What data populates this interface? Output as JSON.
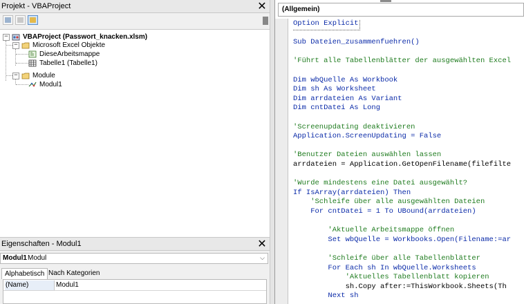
{
  "project_pane": {
    "title": "Projekt - VBAProject",
    "close": "✕",
    "tree": {
      "root": "VBAProject (Passwort_knacken.xlsm)",
      "excel_objects_folder": "Microsoft Excel Objekte",
      "excel_objects": [
        "DieseArbeitsmappe",
        "Tabelle1 (Tabelle1)"
      ],
      "modules_folder": "Module",
      "modules": [
        "Modul1"
      ]
    }
  },
  "properties_pane": {
    "title": "Eigenschaften - Modul1",
    "close": "✕",
    "object_bold": "Modul1",
    "object_type": "Modul",
    "tabs": [
      "Alphabetisch",
      "Nach Kategorien"
    ],
    "rows": [
      {
        "name": "(Name)",
        "value": "Modul1"
      }
    ]
  },
  "code_window": {
    "object_dropdown": "(Allgemein)",
    "lines": [
      {
        "text": "Option Explicit",
        "style": "k"
      },
      {
        "text": "",
        "style": "n"
      },
      {
        "text": "Sub Dateien_zusammenfuehren()",
        "style": "k"
      },
      {
        "text": "",
        "style": "n"
      },
      {
        "text": "'Führt alle Tabellenblätter der ausgewählten Excel",
        "style": "c"
      },
      {
        "text": "",
        "style": "n"
      },
      {
        "text": "Dim wbQuelle As Workbook",
        "style": "k"
      },
      {
        "text": "Dim sh As Worksheet",
        "style": "k"
      },
      {
        "text": "Dim arrdateien As Variant",
        "style": "k"
      },
      {
        "text": "Dim cntDatei As Long",
        "style": "k"
      },
      {
        "text": "",
        "style": "n"
      },
      {
        "text": "'Screenupdating deaktivieren",
        "style": "c"
      },
      {
        "text": "Application.ScreenUpdating = False",
        "style": "k"
      },
      {
        "text": "",
        "style": "n"
      },
      {
        "text": "'Benutzer Dateien auswählen lassen",
        "style": "c"
      },
      {
        "text": "arrdateien = Application.GetOpenFilename(filefilte",
        "style": "n"
      },
      {
        "text": "",
        "style": "n"
      },
      {
        "text": "'Wurde mindestens eine Datei ausgewählt?",
        "style": "c"
      },
      {
        "text": "If IsArray(arrdateien) Then",
        "style": "k"
      },
      {
        "text": "    'Schleife über alle ausgewählten Dateien",
        "style": "c"
      },
      {
        "text": "    For cntDatei = 1 To UBound(arrdateien)",
        "style": "k"
      },
      {
        "text": "",
        "style": "n"
      },
      {
        "text": "        'Aktuelle Arbeitsmappe öffnen",
        "style": "c"
      },
      {
        "text": "        Set wbQuelle = Workbooks.Open(Filename:=ar",
        "style": "k"
      },
      {
        "text": "",
        "style": "n"
      },
      {
        "text": "        'Schleife über alle Tabellenblätter",
        "style": "c"
      },
      {
        "text": "        For Each sh In wbQuelle.Worksheets",
        "style": "k"
      },
      {
        "text": "            'Aktuelles Tabellenblatt kopieren",
        "style": "c"
      },
      {
        "text": "            sh.Copy after:=ThisWorkbook.Sheets(Th",
        "style": "n"
      },
      {
        "text": "        Next sh",
        "style": "k"
      }
    ]
  }
}
